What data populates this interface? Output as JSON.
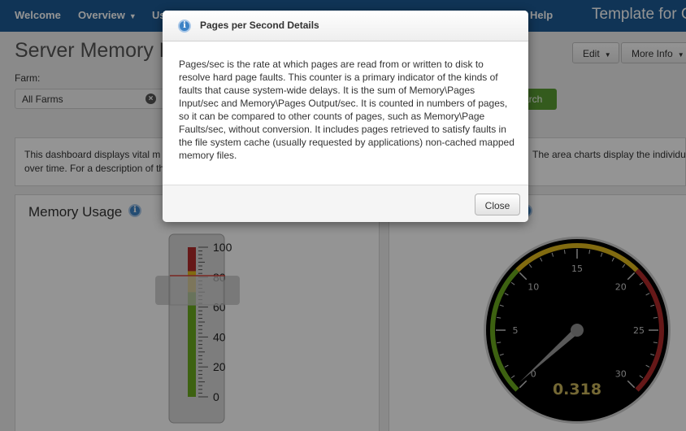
{
  "nav": {
    "items": [
      {
        "label": "Welcome",
        "has_caret": false
      },
      {
        "label": "Overview",
        "has_caret": true
      },
      {
        "label": "Us",
        "has_caret": false
      },
      {
        "label": "Help",
        "has_caret": false
      }
    ],
    "app_title": "Template for C"
  },
  "header": {
    "page_title": "Server Memory D",
    "edit_label": "Edit",
    "more_info_label": "More Info"
  },
  "filter": {
    "farm_label": "Farm:",
    "farm_value": "All Farms",
    "search_label": "arch"
  },
  "description": {
    "line1_left": "This dashboard displays vital m",
    "line2_left": "over time. For a description of th",
    "line1_right": "The area charts display the individu"
  },
  "panels": {
    "memory_usage_title": "Memory Usage"
  },
  "gauges": {
    "memory_usage": {
      "value": 81,
      "ticks": [
        "100",
        "80",
        "60",
        "40",
        "20",
        "0"
      ],
      "range": [
        0,
        100
      ],
      "bands": [
        {
          "from": 0,
          "to": 70,
          "color": "#6aaa1e"
        },
        {
          "from": 70,
          "to": 84,
          "color": "#e0b91c"
        },
        {
          "from": 84,
          "to": 100,
          "color": "#b02a2a"
        }
      ]
    },
    "pages_per_second": {
      "value": 0.318,
      "value_text": "0.318",
      "range": [
        0,
        30
      ],
      "ticks": [
        "0",
        "5",
        "10",
        "15",
        "20",
        "25",
        "30"
      ],
      "bands": [
        {
          "from": 0,
          "to": 10,
          "color": "#6aaa1e"
        },
        {
          "from": 10,
          "to": 20,
          "color": "#e0b91c"
        },
        {
          "from": 20,
          "to": 30,
          "color": "#b02a2a"
        }
      ]
    }
  },
  "modal": {
    "title": "Pages per Second Details",
    "body": "Pages/sec is the rate at which pages are read from or written to disk to resolve hard page faults. This counter is a primary indicator of the kinds of faults that cause system-wide delays. It is the sum of Memory\\Pages Input/sec and Memory\\Pages Output/sec. It is counted in numbers of pages, so it can be compared to other counts of pages, such as Memory\\Page Faults/sec, without conversion. It includes pages retrieved to satisfy faults in the file system cache (usually requested by applications) non-cached mapped memory files.",
    "close_label": "Close"
  },
  "colors": {
    "nav_bg": "#1c5b94",
    "primary_button": "#5a9e32",
    "info_icon": "#3d83c6",
    "gauge_value_text": "#c9b45b"
  }
}
